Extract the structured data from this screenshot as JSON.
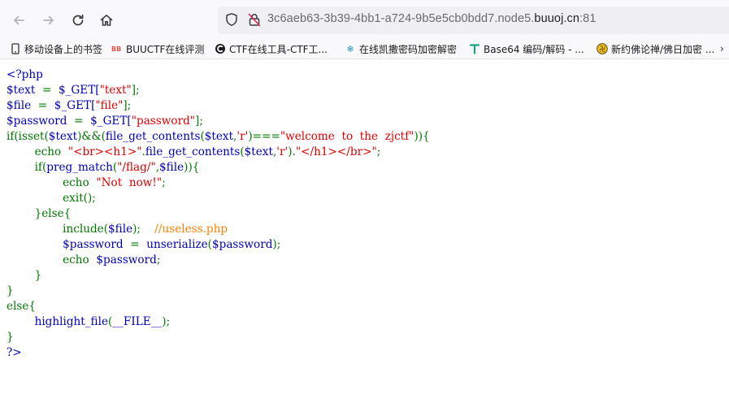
{
  "browser": {
    "nav": {
      "back_icon": "arrow-left-icon",
      "forward_icon": "arrow-right-icon",
      "reload_icon": "reload-icon",
      "home_icon": "home-icon"
    },
    "url": {
      "prefix": "3c6aeb63-3b39-4bb1-a724-9b5e5cb0bdd7.node5.",
      "domain": "buuoj.cn",
      "suffix": ":81"
    }
  },
  "bookmarks": [
    {
      "label": "移动设备上的书签",
      "icon": "mobile-icon"
    },
    {
      "label": "BUUCTF在线评测",
      "icon": "buuctf-icon"
    },
    {
      "label": "CTF在线工具-CTF工...",
      "icon": "ctf-tool-icon"
    },
    {
      "label": "在线凯撒密码加密解密",
      "icon": "snowflake-icon"
    },
    {
      "label": "Base64 编码/解码 - ...",
      "icon": "base64-icon"
    },
    {
      "label": "新约佛论禅/佛日加密 ...",
      "icon": "buddha-icon"
    }
  ],
  "code": {
    "l1": "<?php",
    "l2": [
      "$text",
      "  =  ",
      "$_GET[",
      "\"text\"",
      "];"
    ],
    "l3": [
      "$file",
      "  =  ",
      "$_GET[",
      "\"file\"",
      "];"
    ],
    "l4": [
      "$password",
      "  =  ",
      "$_GET[",
      "\"password\"",
      "];"
    ],
    "l5": [
      "if(isset(",
      "$text",
      ")&&(",
      "file_get_contents",
      "(",
      "$text",
      ",",
      "'r'",
      ")===",
      "\"welcome  to  the  zjctf\"",
      ")){"
    ],
    "l6": [
      "        echo  ",
      "\"<br><h1>\"",
      ".",
      "file_get_contents",
      "(",
      "$text",
      ",",
      "'r'",
      ").",
      "\"</h1></br>\"",
      ";"
    ],
    "l7": [
      "        if(",
      "preg_match",
      "(",
      "\"/flag/\"",
      ",",
      "$file",
      ")){"
    ],
    "l8": [
      "                echo  ",
      "\"Not  now!\"",
      ";"
    ],
    "l9": [
      "                exit",
      "();"
    ],
    "l10": "        }else{",
    "l11": [
      "                include(",
      "$file",
      ");    ",
      "//useless.php"
    ],
    "l12": [
      "                $password",
      "  =  ",
      "unserialize",
      "(",
      "$password",
      ");"
    ],
    "l13": [
      "                echo  ",
      "$password",
      ";"
    ],
    "l14": "        }",
    "l15": "}",
    "l16": "else{",
    "l17": [
      "        ",
      "highlight_file",
      "(",
      "__FILE__",
      ");"
    ],
    "l18": "}",
    "l19": "?>"
  }
}
